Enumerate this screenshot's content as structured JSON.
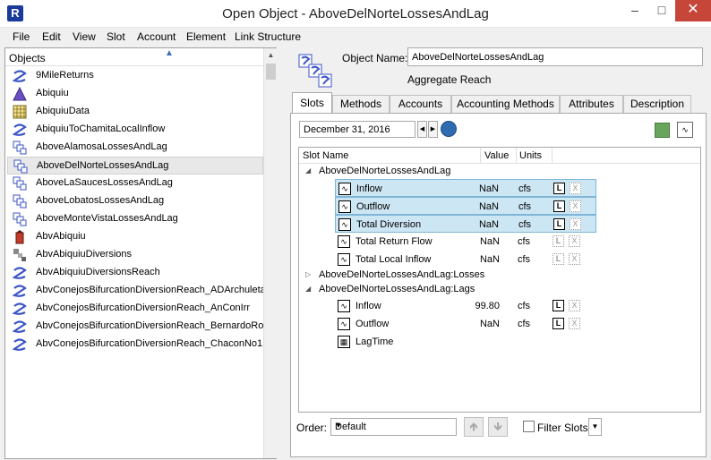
{
  "window": {
    "title": "Open Object - AboveDelNorteLossesAndLag",
    "app_icon": "riverware-icon",
    "controls": {
      "minimize": "–",
      "maximize": "□",
      "close": "✕"
    }
  },
  "menu": [
    "File",
    "Edit",
    "View",
    "Slot",
    "Account",
    "Element",
    "Link Structure"
  ],
  "objects_panel": {
    "header": "Objects",
    "items": [
      {
        "label": "9MileReturns",
        "icon": "reach-icon"
      },
      {
        "label": "Abiquiu",
        "icon": "reservoir-icon"
      },
      {
        "label": "AbiquiuData",
        "icon": "data-object-icon"
      },
      {
        "label": "AbiquiuToChamitaLocalInflow",
        "icon": "reach-icon"
      },
      {
        "label": "AboveAlamosaLossesAndLag",
        "icon": "aggregate-reach-icon"
      },
      {
        "label": "AboveDelNorteLossesAndLag",
        "icon": "aggregate-reach-icon",
        "selected": true
      },
      {
        "label": "AboveLaSaucesLossesAndLag",
        "icon": "aggregate-reach-icon"
      },
      {
        "label": "AboveLobatosLossesAndLag",
        "icon": "aggregate-reach-icon"
      },
      {
        "label": "AboveMonteVistaLossesAndLag",
        "icon": "aggregate-reach-icon"
      },
      {
        "label": "AbvAbiquiu",
        "icon": "gage-icon"
      },
      {
        "label": "AbvAbiquiuDiversions",
        "icon": "diversion-icon"
      },
      {
        "label": "AbvAbiquiuDiversionsReach",
        "icon": "reach-icon"
      },
      {
        "label": "AbvConejosBifurcationDiversionReach_ADArchuleta",
        "icon": "reach-icon"
      },
      {
        "label": "AbvConejosBifurcationDiversionReach_AnConIrr",
        "icon": "reach-icon"
      },
      {
        "label": "AbvConejosBifurcationDiversionReach_BernardoRome",
        "icon": "reach-icon"
      },
      {
        "label": "AbvConejosBifurcationDiversionReach_ChaconNo1",
        "icon": "reach-icon"
      }
    ]
  },
  "object": {
    "name_label": "Object Name:",
    "name_value": "AboveDelNorteLossesAndLag",
    "type": "Aggregate Reach"
  },
  "tabs": [
    "Slots",
    "Methods",
    "Accounts",
    "Accounting Methods",
    "Attributes",
    "Description"
  ],
  "date": "December 31, 2016",
  "slot_table": {
    "columns": [
      "Slot Name",
      "Value",
      "Units"
    ],
    "groups": [
      {
        "label": "AboveDelNorteLossesAndLag",
        "expanded": true,
        "slots": [
          {
            "name": "Inflow",
            "value": "NaN",
            "units": "cfs",
            "selected": true,
            "flag_active": true
          },
          {
            "name": "Outflow",
            "value": "NaN",
            "units": "cfs",
            "selected": true,
            "flag_active": true
          },
          {
            "name": "Total Diversion",
            "value": "NaN",
            "units": "cfs",
            "selected": true,
            "flag_active": true
          },
          {
            "name": "Total Return Flow",
            "value": "NaN",
            "units": "cfs",
            "selected": false,
            "flag_active": false
          },
          {
            "name": "Total Local Inflow",
            "value": "NaN",
            "units": "cfs",
            "selected": false,
            "flag_active": false
          }
        ]
      },
      {
        "label": "AboveDelNorteLossesAndLag:Losses",
        "expanded": false,
        "slots": []
      },
      {
        "label": "AboveDelNorteLossesAndLag:Lags",
        "expanded": true,
        "slots": [
          {
            "name": "Inflow",
            "value": "99.80",
            "units": "cfs",
            "selected": false,
            "flag_active": true
          },
          {
            "name": "Outflow",
            "value": "NaN",
            "units": "cfs",
            "selected": false,
            "flag_active": true
          },
          {
            "name": "LagTime",
            "value": "",
            "units": "",
            "selected": false,
            "table": true
          }
        ]
      }
    ],
    "flag_L": "L",
    "flag_X": "X"
  },
  "bottom": {
    "order_label": "Order:",
    "order_value": "Default",
    "filter_label": "Filter Slots"
  },
  "colors": {
    "selection": "#cde6f3",
    "selection_border": "#7fb6d8",
    "status_green": "#68a55c",
    "close_red": "#c7463a"
  }
}
